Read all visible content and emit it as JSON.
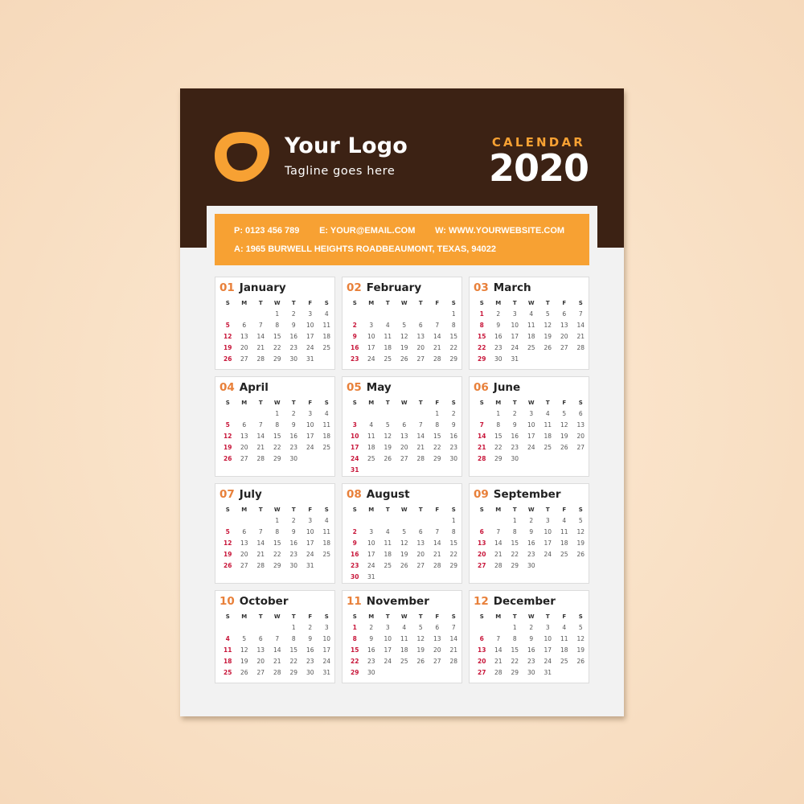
{
  "brand": {
    "logo_name": "Your Logo",
    "tagline": "Tagline goes here",
    "logo_icon": "rounded-ring-logo-icon",
    "colors": {
      "header_bg": "#3c2214",
      "accent_orange": "#f7a133",
      "month_number": "#e8803a",
      "sunday_red": "#c8163a",
      "paper": "#f2f2f2",
      "background": "#f9e1c6"
    }
  },
  "calendar": {
    "label": "CALENDAR",
    "year": "2020"
  },
  "contact": {
    "phone": "P: 0123 456 789",
    "email": "E: YOUR@EMAIL.COM",
    "website": "W: WWW.YOURWEBSITE.COM",
    "address": "A: 1965  BURWELL HEIGHTS ROADBEAUMONT, TEXAS, 94022"
  },
  "weekdays": [
    "S",
    "M",
    "T",
    "W",
    "T",
    "F",
    "S"
  ],
  "months": [
    {
      "num": "01",
      "name": "January",
      "start": 3,
      "days": 31
    },
    {
      "num": "02",
      "name": "February",
      "start": 6,
      "days": 29
    },
    {
      "num": "03",
      "name": "March",
      "start": 0,
      "days": 31
    },
    {
      "num": "04",
      "name": "April",
      "start": 3,
      "days": 30
    },
    {
      "num": "05",
      "name": "May",
      "start": 5,
      "days": 31
    },
    {
      "num": "06",
      "name": "June",
      "start": 1,
      "days": 30
    },
    {
      "num": "07",
      "name": "July",
      "start": 3,
      "days": 31
    },
    {
      "num": "08",
      "name": "August",
      "start": 6,
      "days": 31
    },
    {
      "num": "09",
      "name": "September",
      "start": 2,
      "days": 30
    },
    {
      "num": "10",
      "name": "October",
      "start": 4,
      "days": 31
    },
    {
      "num": "11",
      "name": "November",
      "start": 0,
      "days": 30
    },
    {
      "num": "12",
      "name": "December",
      "start": 2,
      "days": 31
    }
  ]
}
